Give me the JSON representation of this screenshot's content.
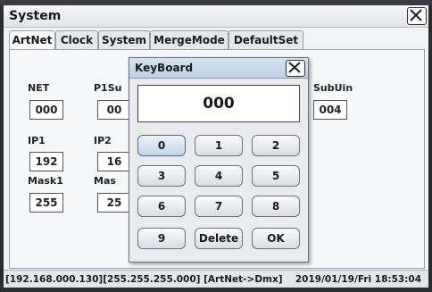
{
  "window": {
    "title": "System",
    "close_icon": "close-icon"
  },
  "tabs": [
    "ArtNet",
    "Clock",
    "System",
    "MergeMode",
    "DefaultSet"
  ],
  "fields": {
    "net": {
      "label": "NET",
      "value": "000"
    },
    "p1sub": {
      "label": "P1Su",
      "value": "00"
    },
    "subuin": {
      "label": "SubUin",
      "value": "004"
    },
    "ip1": {
      "label": "IP1",
      "value": "192"
    },
    "ip2": {
      "label": "IP2",
      "value": "16"
    },
    "mask1": {
      "label": "Mask1",
      "value": "255"
    },
    "mask2": {
      "label": "Mas",
      "value": "25"
    }
  },
  "keyboard": {
    "title": "KeyBoard",
    "display": "000",
    "keys": [
      "0",
      "1",
      "2",
      "3",
      "4",
      "5",
      "6",
      "7",
      "8",
      "9",
      "Delete",
      "OK"
    ]
  },
  "status": {
    "left": "[192.168.000.130][255.255.255.000] [ArtNet->Dmx]",
    "right": "2019/01/19/Fri 18:53:04"
  }
}
